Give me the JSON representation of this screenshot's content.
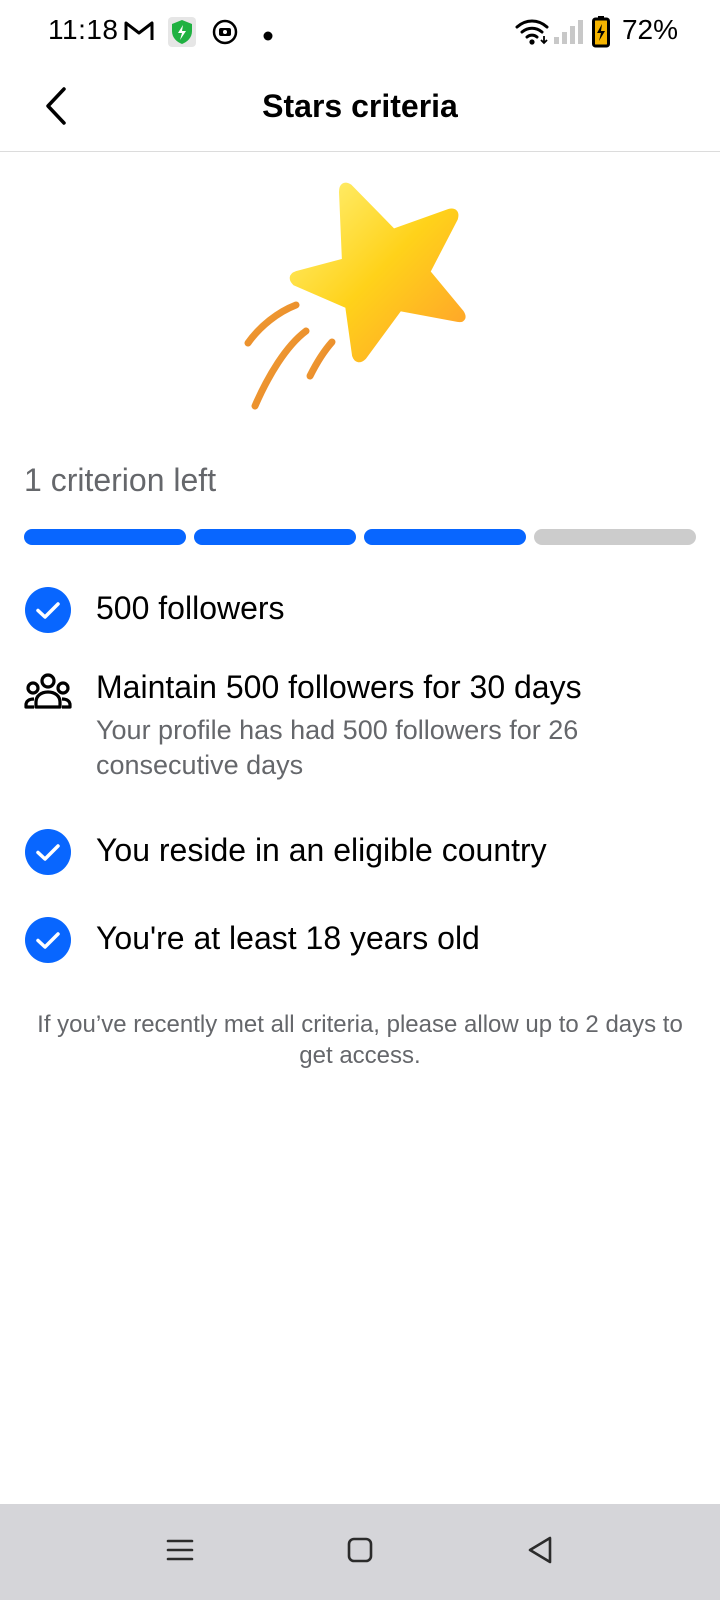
{
  "status_bar": {
    "time": "11:18",
    "battery_percent": "72%",
    "icons": [
      "gmail-icon",
      "shield-icon",
      "media-icon",
      "dot-icon",
      "wifi-icon",
      "signal-icon",
      "battery-icon"
    ]
  },
  "header": {
    "title": "Stars criteria",
    "back_icon": "chevron-left-icon"
  },
  "hero": {
    "icon": "shooting-star-icon"
  },
  "progress": {
    "label": "1 criterion left",
    "total_segments": 4,
    "completed_segments": 3,
    "complete_color": "#0866ff",
    "incomplete_color": "#cccccc"
  },
  "criteria": [
    {
      "title": "500 followers",
      "status": "complete",
      "icon": "check-circle-icon"
    },
    {
      "title": "Maintain 500 followers for 30 days",
      "subtitle": "Your profile has had 500 followers for 26 consecutive days",
      "status": "incomplete",
      "icon": "people-group-icon"
    },
    {
      "title": "You reside in an eligible country",
      "status": "complete",
      "icon": "check-circle-icon"
    },
    {
      "title": "You're at least 18 years old",
      "status": "complete",
      "icon": "check-circle-icon"
    }
  ],
  "footnote": "If you’ve recently met all criteria, please allow up to 2 days to get access.",
  "nav_bar": {
    "icons": [
      "menu-icon",
      "home-square-icon",
      "back-triangle-icon"
    ]
  },
  "colors": {
    "accent": "#0866ff",
    "secondary_text": "#65676b",
    "nav_background": "#d5d5d9"
  }
}
